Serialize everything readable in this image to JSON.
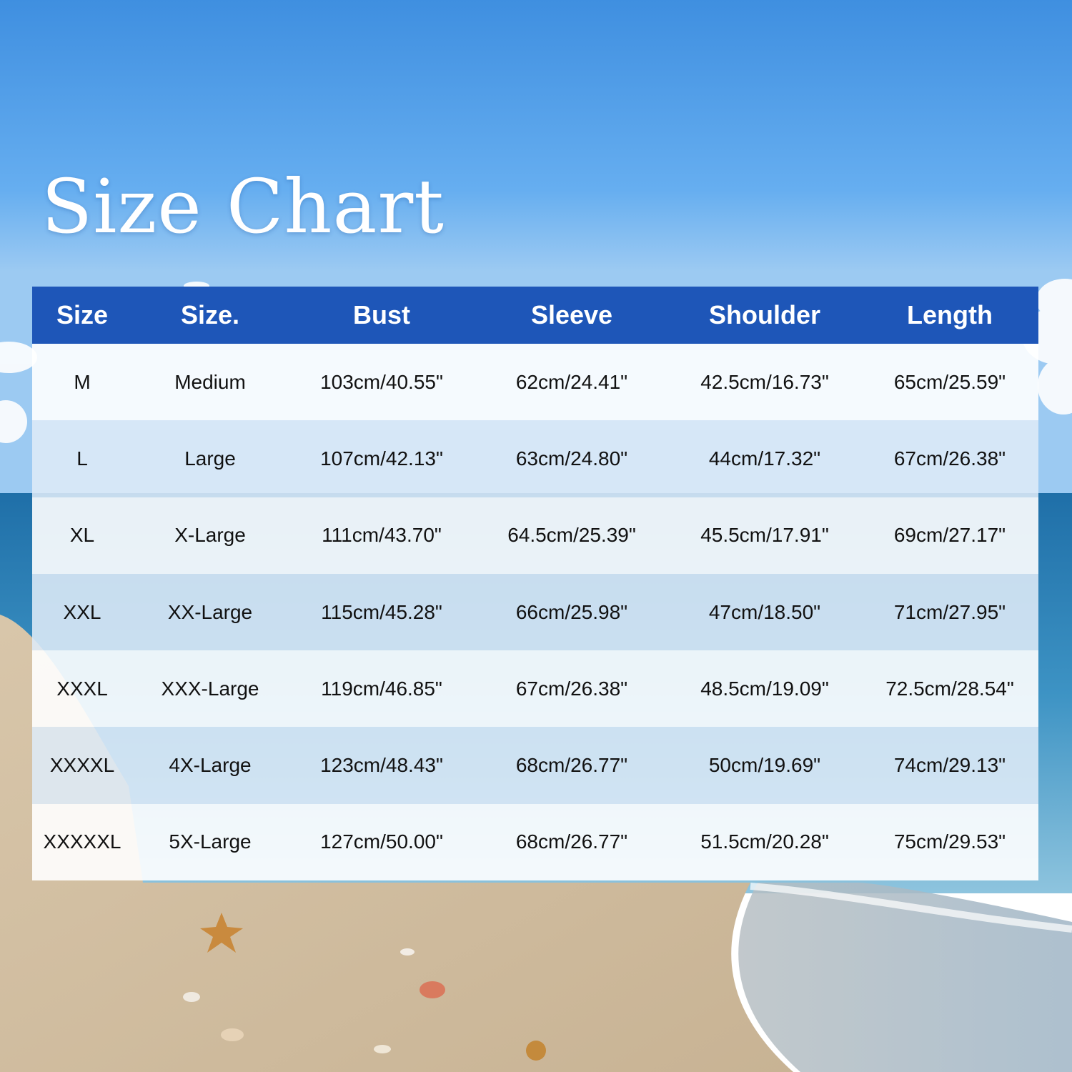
{
  "title": "Size Chart",
  "header_color": "#1e56b8",
  "columns": [
    "Size",
    "Size.",
    "Bust",
    "Sleeve",
    "Shoulder",
    "Length"
  ],
  "rows": [
    [
      "M",
      "Medium",
      "103cm/40.55\"",
      "62cm/24.41\"",
      "42.5cm/16.73\"",
      "65cm/25.59\""
    ],
    [
      "L",
      "Large",
      "107cm/42.13\"",
      "63cm/24.80\"",
      "44cm/17.32\"",
      "67cm/26.38\""
    ],
    [
      "XL",
      "X-Large",
      "111cm/43.70\"",
      "64.5cm/25.39\"",
      "45.5cm/17.91\"",
      "69cm/27.17\""
    ],
    [
      "XXL",
      "XX-Large",
      "115cm/45.28\"",
      "66cm/25.98\"",
      "47cm/18.50\"",
      "71cm/27.95\""
    ],
    [
      "XXXL",
      "XXX-Large",
      "119cm/46.85\"",
      "67cm/26.38\"",
      "48.5cm/19.09\"",
      "72.5cm/28.54\""
    ],
    [
      "XXXXL",
      "4X-Large",
      "123cm/48.43\"",
      "68cm/26.77\"",
      "50cm/19.69\"",
      "74cm/29.13\""
    ],
    [
      "XXXXXL",
      "5X-Large",
      "127cm/50.00\"",
      "68cm/26.77\"",
      "51.5cm/20.28\"",
      "75cm/29.53\""
    ]
  ]
}
